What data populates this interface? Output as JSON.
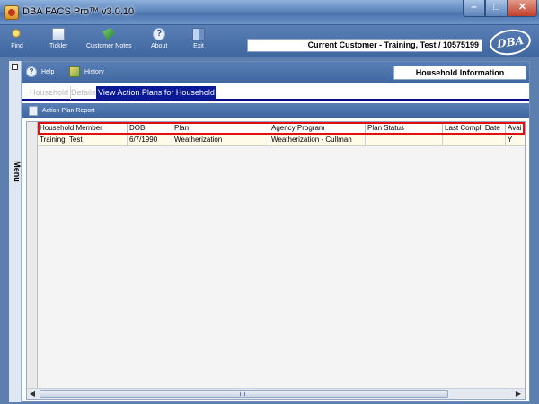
{
  "window": {
    "title": "DBA FACS Pro™ v3.0.10"
  },
  "toolbar": {
    "buttons": [
      {
        "label": "Find",
        "icon": "find-icon"
      },
      {
        "label": "Tickler",
        "icon": "tickler-icon"
      },
      {
        "label": "Customer Notes",
        "icon": "customer-notes-icon"
      },
      {
        "label": "About",
        "icon": "about-icon"
      },
      {
        "label": "Exit",
        "icon": "exit-icon"
      }
    ],
    "current_customer": "Current Customer - Training, Test / 10575199",
    "logo_text": "DBA"
  },
  "sidebar": {
    "menu_label": "Menu"
  },
  "subtoolbar": {
    "help_label": "Help",
    "history_label": "History",
    "panel_title": "Household Information"
  },
  "tabs": [
    {
      "label": "Household",
      "active": false
    },
    {
      "label": "Details",
      "active": false
    },
    {
      "label": "View Action Plans for Household",
      "active": true
    }
  ],
  "report": {
    "label": "Action Plan Report"
  },
  "grid": {
    "columns": [
      "Household Member",
      "DOB",
      "Plan",
      "Agency Program",
      "Plan Status",
      "Last Compl. Date",
      "Avai"
    ],
    "rows": [
      [
        "Training, Test",
        "6/7/1990",
        "Weatherization",
        "Weatherization - Cullman",
        "",
        "",
        "Y"
      ]
    ]
  },
  "colors": {
    "toolbar_blue": "#4a73ad",
    "active_tab": "#0a1a96",
    "highlight_border": "#e01010",
    "row_background": "#fffbe9"
  }
}
